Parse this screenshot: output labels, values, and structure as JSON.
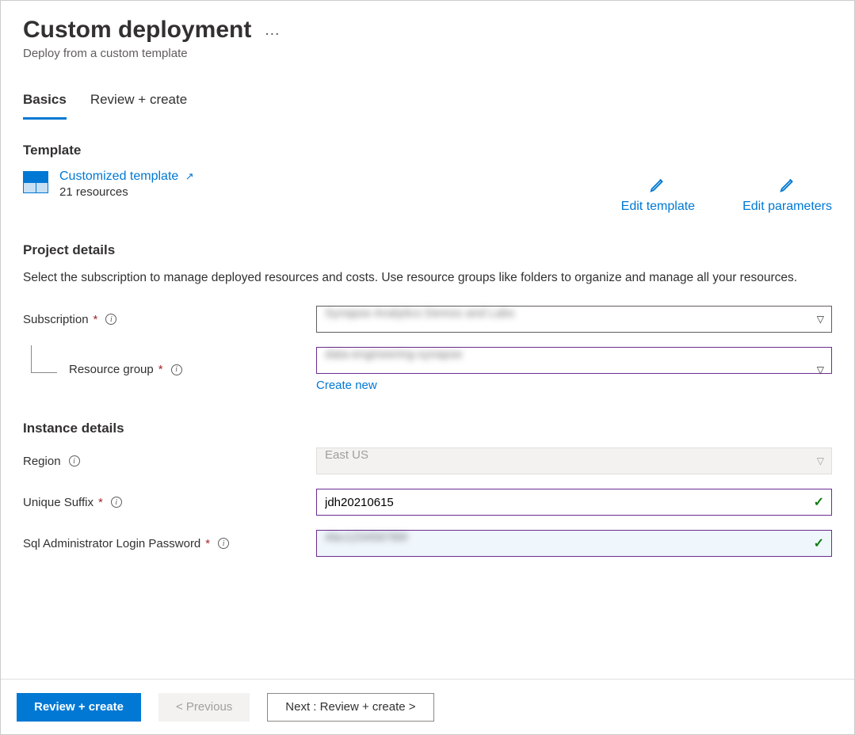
{
  "header": {
    "title": "Custom deployment",
    "subtitle": "Deploy from a custom template",
    "more": "…"
  },
  "tabs": {
    "basics": "Basics",
    "review": "Review + create"
  },
  "template_section": {
    "heading": "Template",
    "link_text": "Customized template",
    "resources_text": "21 resources",
    "edit_template": "Edit template",
    "edit_parameters": "Edit parameters"
  },
  "project_details": {
    "heading": "Project details",
    "desc": "Select the subscription to manage deployed resources and costs. Use resource groups like folders to organize and manage all your resources.",
    "subscription_label": "Subscription",
    "subscription_value": "Synapse Analytics Demos and Labs",
    "resource_group_label": "Resource group",
    "resource_group_value": "data-engineering-synapse",
    "create_new": "Create new"
  },
  "instance_details": {
    "heading": "Instance details",
    "region_label": "Region",
    "region_value": "East US",
    "suffix_label": "Unique Suffix",
    "suffix_value": "jdh20210615",
    "password_label": "Sql Administrator Login Password",
    "password_value": "Abc123456789!"
  },
  "footer": {
    "review_create": "Review + create",
    "previous": "< Previous",
    "next": "Next : Review + create >"
  }
}
